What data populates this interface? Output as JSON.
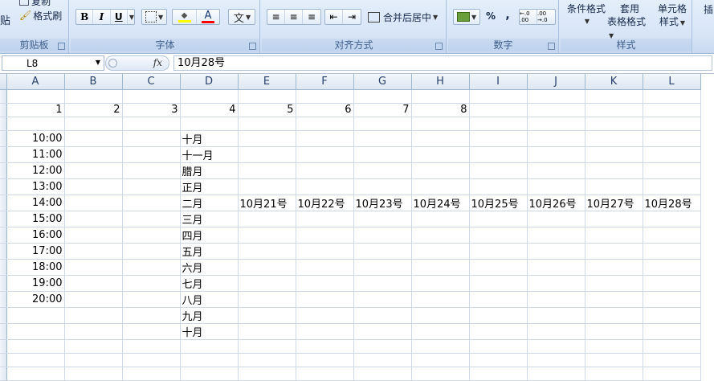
{
  "ribbon": {
    "clipboard": {
      "paste_partial": "贴",
      "copy_partial": "复制",
      "format_painter": "格式刷",
      "label": "剪贴板"
    },
    "font": {
      "bold": "B",
      "italic": "I",
      "underline": "U",
      "fill_glyph": "◆",
      "color_glyph": "A",
      "wen_glyph": "文",
      "label": "字体"
    },
    "alignment": {
      "merge_center": "合并后居中",
      "label": "对齐方式"
    },
    "number": {
      "percent": "%",
      "comma": ",",
      "inc_decimal": "←.0 .00",
      "dec_decimal": ".00 →.0",
      "label": "数字"
    },
    "styles": {
      "conditional": "条件格式",
      "table_fmt_1": "套用",
      "table_fmt_2": "表格格式",
      "cell_style_1": "单元格",
      "cell_style_2": "样式",
      "label": "样式"
    },
    "insert_partial": "插"
  },
  "formula_bar": {
    "name_box": "L8",
    "fx": "fx",
    "content": "10月28号"
  },
  "columns": [
    "A",
    "B",
    "C",
    "D",
    "E",
    "F",
    "G",
    "H",
    "I",
    "J",
    "K",
    "L"
  ],
  "rows": [
    [
      "",
      "",
      "",
      "",
      "",
      "",
      "",
      "",
      "",
      "",
      "",
      ""
    ],
    [
      "1",
      "2",
      "3",
      "4",
      "5",
      "6",
      "7",
      "8",
      "",
      "",
      "",
      ""
    ],
    [
      "",
      "",
      "",
      "",
      "",
      "",
      "",
      "",
      "",
      "",
      "",
      ""
    ],
    [
      "10:00",
      "",
      "",
      "十月",
      "",
      "",
      "",
      "",
      "",
      "",
      "",
      ""
    ],
    [
      "11:00",
      "",
      "",
      "十一月",
      "",
      "",
      "",
      "",
      "",
      "",
      "",
      ""
    ],
    [
      "12:00",
      "",
      "",
      "腊月",
      "",
      "",
      "",
      "",
      "",
      "",
      "",
      ""
    ],
    [
      "13:00",
      "",
      "",
      "正月",
      "",
      "",
      "",
      "",
      "",
      "",
      "",
      ""
    ],
    [
      "14:00",
      "",
      "",
      "二月",
      "10月21号",
      "10月22号",
      "10月23号",
      "10月24号",
      "10月25号",
      "10月26号",
      "10月27号",
      "10月28号"
    ],
    [
      "15:00",
      "",
      "",
      "三月",
      "",
      "",
      "",
      "",
      "",
      "",
      "",
      ""
    ],
    [
      "16:00",
      "",
      "",
      "四月",
      "",
      "",
      "",
      "",
      "",
      "",
      "",
      ""
    ],
    [
      "17:00",
      "",
      "",
      "五月",
      "",
      "",
      "",
      "",
      "",
      "",
      "",
      ""
    ],
    [
      "18:00",
      "",
      "",
      "六月",
      "",
      "",
      "",
      "",
      "",
      "",
      "",
      ""
    ],
    [
      "19:00",
      "",
      "",
      "七月",
      "",
      "",
      "",
      "",
      "",
      "",
      "",
      ""
    ],
    [
      "20:00",
      "",
      "",
      "八月",
      "",
      "",
      "",
      "",
      "",
      "",
      "",
      ""
    ],
    [
      "",
      "",
      "",
      "九月",
      "",
      "",
      "",
      "",
      "",
      "",
      "",
      ""
    ],
    [
      "",
      "",
      "",
      "十月",
      "",
      "",
      "",
      "",
      "",
      "",
      "",
      ""
    ],
    [
      "",
      "",
      "",
      "",
      "",
      "",
      "",
      "",
      "",
      "",
      "",
      ""
    ],
    [
      "",
      "",
      "",
      "",
      "",
      "",
      "",
      "",
      "",
      "",
      "",
      ""
    ],
    [
      "",
      "",
      "",
      "",
      "",
      "",
      "",
      "",
      "",
      "",
      "",
      ""
    ]
  ]
}
